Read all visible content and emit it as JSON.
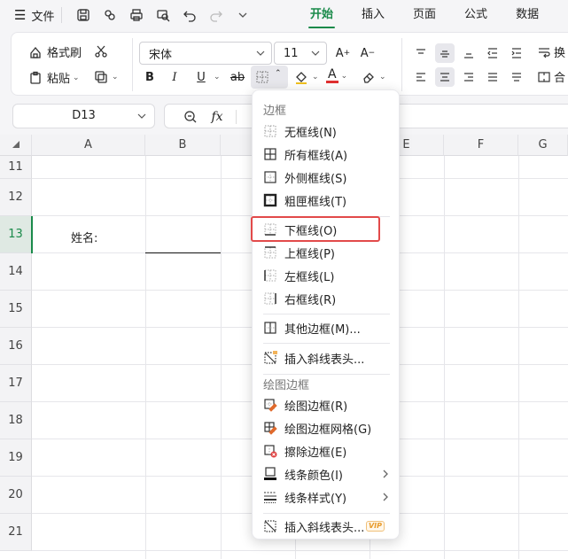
{
  "topbar": {
    "menu_icon": "hamburger-icon",
    "file_label": "文件",
    "quick_icons": [
      "save-icon",
      "format-painter-icon",
      "print-icon",
      "print-preview-icon",
      "undo-icon",
      "redo-icon",
      "chevron-down-icon"
    ],
    "tabs": [
      {
        "label": "开始",
        "active": true
      },
      {
        "label": "插入",
        "active": false
      },
      {
        "label": "页面",
        "active": false
      },
      {
        "label": "公式",
        "active": false
      },
      {
        "label": "数据",
        "active": false
      }
    ]
  },
  "ribbon": {
    "format_painter": "格式刷",
    "paste": "粘贴",
    "font_name": "宋体",
    "font_size": "11",
    "bold": "B",
    "italic": "I",
    "underline": "U",
    "strike": "ab",
    "font_color": "A",
    "wrap_label": "换",
    "merge_label": "合"
  },
  "formula_bar": {
    "name_box": "D13"
  },
  "grid": {
    "columns": [
      "A",
      "B",
      "",
      "",
      "E",
      "F",
      "G"
    ],
    "rows": [
      "11",
      "12",
      "13",
      "14",
      "15",
      "16",
      "17",
      "18",
      "19",
      "20",
      "21"
    ],
    "selected_row": "13",
    "cell_a13": "姓名:"
  },
  "border_menu": {
    "section1_title": "边框",
    "section2_title": "绘图边框",
    "items": [
      {
        "label": "无框线(N)",
        "icon": "no-border-icon"
      },
      {
        "label": "所有框线(A)",
        "icon": "all-borders-icon"
      },
      {
        "label": "外侧框线(S)",
        "icon": "outside-borders-icon"
      },
      {
        "label": "粗匣框线(T)",
        "icon": "thick-box-border-icon"
      },
      {
        "label": "下框线(O)",
        "icon": "bottom-border-icon"
      },
      {
        "label": "上框线(P)",
        "icon": "top-border-icon"
      },
      {
        "label": "左框线(L)",
        "icon": "left-border-icon"
      },
      {
        "label": "右框线(R)",
        "icon": "right-border-icon"
      },
      {
        "label": "其他边框(M)...",
        "icon": "more-borders-icon"
      },
      {
        "label": "插入斜线表头...",
        "icon": "diagonal-header-icon"
      },
      {
        "label": "绘图边框(R)",
        "icon": "draw-border-icon"
      },
      {
        "label": "绘图边框网格(G)",
        "icon": "draw-border-grid-icon"
      },
      {
        "label": "擦除边框(E)",
        "icon": "erase-border-icon"
      },
      {
        "label": "线条颜色(I)",
        "icon": "line-color-icon"
      },
      {
        "label": "线条样式(Y)",
        "icon": "line-style-icon"
      },
      {
        "label": "插入斜线表头...",
        "icon": "diagonal-header-icon"
      }
    ],
    "vip_badge": "VIP"
  },
  "colors": {
    "accent": "#1a8a4a",
    "highlight": "#e24a4a",
    "font_color_bar": "#e03030"
  }
}
